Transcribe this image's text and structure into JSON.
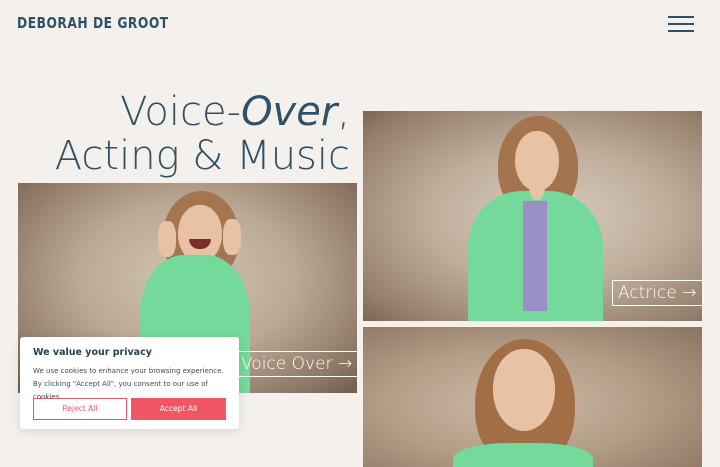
{
  "header": {
    "logo": "DEBORAH DE GROOT",
    "menu_icon": "hamburger-menu-icon"
  },
  "hero": {
    "title_part1": "Voice-",
    "title_italic": "Over",
    "title_part2": ",",
    "title_line2": "Acting & Music"
  },
  "cards": {
    "actrice": {
      "label": "Actrice",
      "arrow": "→"
    },
    "voice_over": {
      "label": "Voice Over",
      "arrow": "→"
    }
  },
  "cookie": {
    "title": "We value your privacy",
    "text": "We use cookies to enhance your browsing experience. By clicking \"Accept All\", you consent to our use of cookies.",
    "reject_label": "Reject All",
    "accept_label": "Accept All"
  },
  "colors": {
    "background": "#f4f1ec",
    "brand": "#2f5167",
    "accent": "#f25664",
    "jacket": "#74d99a"
  }
}
